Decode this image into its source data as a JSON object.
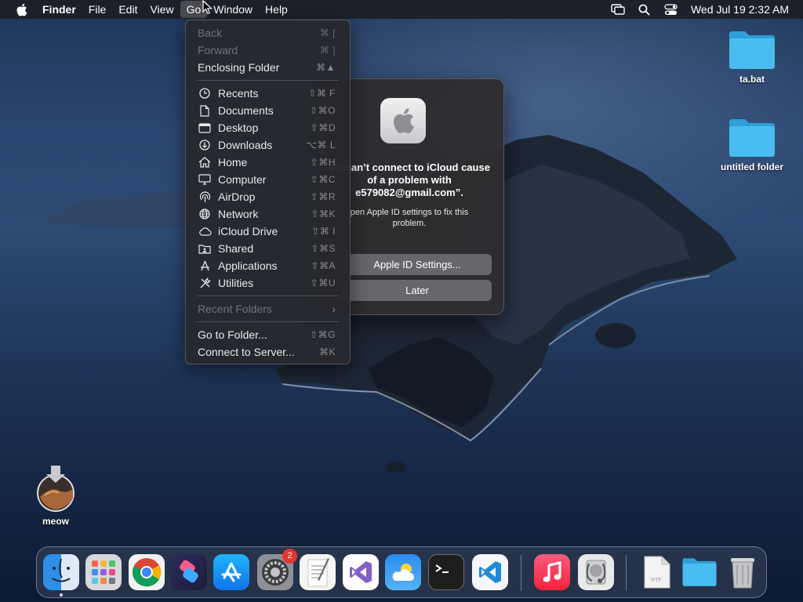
{
  "menubar": {
    "app_name": "Finder",
    "items": [
      "File",
      "Edit",
      "View",
      "Go",
      "Window",
      "Help"
    ],
    "active_item": "Go",
    "clock": "Wed Jul 19  2:32 AM"
  },
  "go_menu": {
    "back": {
      "label": "Back",
      "shortcut": "⌘ ["
    },
    "forward": {
      "label": "Forward",
      "shortcut": "⌘ ]"
    },
    "enclosing": {
      "label": "Enclosing Folder",
      "shortcut": "⌘▲"
    },
    "places": [
      {
        "label": "Recents",
        "shortcut": "⇧⌘ F",
        "icon": "clock-icon"
      },
      {
        "label": "Documents",
        "shortcut": "⇧⌘O",
        "icon": "document-icon"
      },
      {
        "label": "Desktop",
        "shortcut": "⇧⌘D",
        "icon": "desktop-icon"
      },
      {
        "label": "Downloads",
        "shortcut": "⌥⌘ L",
        "icon": "download-icon"
      },
      {
        "label": "Home",
        "shortcut": "⇧⌘H",
        "icon": "home-icon"
      },
      {
        "label": "Computer",
        "shortcut": "⇧⌘C",
        "icon": "computer-icon"
      },
      {
        "label": "AirDrop",
        "shortcut": "⇧⌘R",
        "icon": "airdrop-icon"
      },
      {
        "label": "Network",
        "shortcut": "⇧⌘K",
        "icon": "globe-icon"
      },
      {
        "label": "iCloud Drive",
        "shortcut": "⇧⌘ I",
        "icon": "cloud-icon"
      },
      {
        "label": "Shared",
        "shortcut": "⇧⌘S",
        "icon": "shared-folder-icon"
      },
      {
        "label": "Applications",
        "shortcut": "⇧⌘A",
        "icon": "applications-icon"
      },
      {
        "label": "Utilities",
        "shortcut": "⇧⌘U",
        "icon": "utilities-icon"
      }
    ],
    "recent_folders": "Recent Folders",
    "go_to_folder": {
      "label": "Go to Folder...",
      "shortcut": "⇧⌘G"
    },
    "connect_server": {
      "label": "Connect to Server...",
      "shortcut": "⌘K"
    }
  },
  "alert": {
    "title": "lac can’t connect to iCloud cause of a problem with e579082@gmail.com”.",
    "body": "pen Apple ID settings to fix this problem.",
    "primary_button": "Apple ID Settings...",
    "secondary_button": "Later"
  },
  "desktop": {
    "icons": [
      {
        "label": "ta.bat",
        "icon": "folder-icon"
      },
      {
        "label": "untitled folder",
        "icon": "folder-icon"
      },
      {
        "label": "meow",
        "icon": "installer-disk-icon"
      }
    ]
  },
  "dock": {
    "apps": [
      {
        "name": "Finder",
        "icon": "finder-icon",
        "running": true
      },
      {
        "name": "Launchpad",
        "icon": "launchpad-icon"
      },
      {
        "name": "Google Chrome",
        "icon": "chrome-icon"
      },
      {
        "name": "Shortcuts",
        "icon": "shortcuts-icon"
      },
      {
        "name": "App Store",
        "icon": "app-store-icon"
      },
      {
        "name": "System Settings",
        "icon": "settings-gear-icon",
        "badge": "2"
      },
      {
        "name": "TextEdit",
        "icon": "textedit-icon"
      },
      {
        "name": "Visual Studio",
        "icon": "visual-studio-icon"
      },
      {
        "name": "Weather",
        "icon": "weather-icon"
      },
      {
        "name": "Terminal",
        "icon": "terminal-icon"
      },
      {
        "name": "VS Code",
        "icon": "vscode-icon"
      },
      {
        "name": "Music",
        "icon": "music-icon"
      },
      {
        "name": "Disk Utility",
        "icon": "disk-utility-icon"
      },
      {
        "name": "RTF Document",
        "icon": "rtf-file-icon",
        "file_label": "RTF"
      },
      {
        "name": "Folder",
        "icon": "dock-folder-icon"
      },
      {
        "name": "Trash",
        "icon": "trash-icon"
      }
    ]
  },
  "colors": {
    "menu_bg": "#26282d",
    "button_bg": "#66676b",
    "folder_blue": "#3fb4ea",
    "badge_red": "#e3372e"
  }
}
